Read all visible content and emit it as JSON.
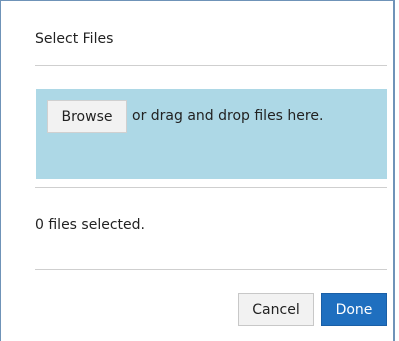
{
  "dialog": {
    "title": "Select Files",
    "dropzone": {
      "browse_label": "Browse",
      "instruction": "or drag and drop files here."
    },
    "status": "0 files selected.",
    "actions": {
      "cancel_label": "Cancel",
      "done_label": "Done"
    }
  },
  "colors": {
    "dropzone_bg": "#add8e6",
    "primary": "#1f6fbf",
    "border": "#6f93b8"
  }
}
